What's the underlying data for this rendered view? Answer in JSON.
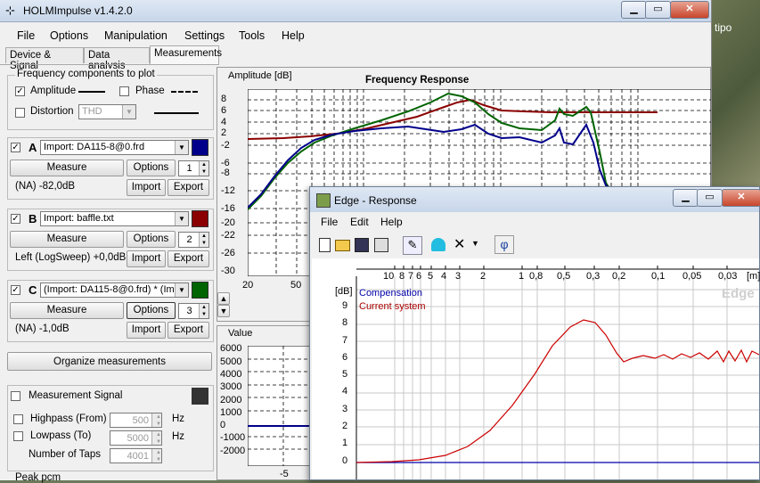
{
  "main_window": {
    "title": "HOLMImpulse   v1.4.2.0",
    "menu": [
      "File",
      "Options",
      "Manipulation",
      "Settings",
      "Tools",
      "Help"
    ],
    "tabs": [
      "Device & Signal",
      "Data analysis",
      "Measurements"
    ],
    "active_tab": "Measurements"
  },
  "freq_components": {
    "group_label": "Frequency components to plot",
    "amplitude_label": "Amplitude",
    "amplitude_checked": true,
    "phase_label": "Phase",
    "phase_checked": false,
    "distortion_label": "Distortion",
    "distortion_checked": false,
    "distortion_select": "THD"
  },
  "measurements": [
    {
      "letter": "A",
      "checked": true,
      "source": "Import: DA115-8@0.frd",
      "color": "#00008b",
      "measure": "Measure",
      "options": "Options",
      "index": "1",
      "info": "(NA) -82,0dB",
      "import": "Import",
      "export": "Export"
    },
    {
      "letter": "B",
      "checked": true,
      "source": "Import: baffle.txt",
      "color": "#8b0000",
      "measure": "Measure",
      "options": "Options",
      "index": "2",
      "info": "Left (LogSweep) +0,0dB",
      "import": "Import",
      "export": "Export"
    },
    {
      "letter": "C",
      "checked": true,
      "source": "(Import: DA115-8@0.frd) * (Impc",
      "color": "#006400",
      "measure": "Measure",
      "options": "Options",
      "index": "3",
      "info": "(NA) -1,0dB",
      "import": "Import",
      "export": "Export"
    }
  ],
  "organize_button": "Organize measurements",
  "measurement_signal": {
    "label": "Measurement Signal",
    "checked": false,
    "color": "#333333"
  },
  "filters": {
    "highpass_label": "Highpass (From)",
    "highpass_value": "500",
    "highpass_unit": "Hz",
    "lowpass_label": "Lowpass (To)",
    "lowpass_value": "5000",
    "lowpass_unit": "Hz",
    "taps_label": "Number of Taps",
    "taps_value": "4001"
  },
  "peak_label": "Peak pcm",
  "freq_plot": {
    "ylabel": "Amplitude [dB]",
    "title": "Frequency Response",
    "yticks": [
      "8",
      "6",
      "4",
      "2",
      "-2",
      "-6",
      "-8",
      "-12",
      "-16",
      "-20",
      "-22",
      "-26",
      "-30"
    ],
    "xticks": [
      "20",
      "50"
    ]
  },
  "value_plot": {
    "label": "Value",
    "yticks": [
      "6000",
      "5000",
      "4000",
      "3000",
      "2000",
      "1000",
      "0",
      "-1000",
      "-2000"
    ],
    "xtick": "-5"
  },
  "edge_window": {
    "title": "Edge - Response",
    "menu": [
      "File",
      "Edit",
      "Help"
    ],
    "toolbar_icons": [
      "new-icon",
      "open-icon",
      "save-icon",
      "copy-icon",
      "pen-icon",
      "person-icon",
      "delete-icon",
      "dropdown-icon",
      "phi-icon"
    ],
    "phi": "φ",
    "top_axis": [
      "10",
      "8",
      "7",
      "6",
      "5",
      "4",
      "3",
      "2",
      "1",
      "0,8",
      "0,5",
      "0,3",
      "0,2",
      "0,1",
      "0,05",
      "0,03",
      "[m]"
    ],
    "yunit": "[dB]",
    "yticks": [
      "9",
      "8",
      "7",
      "6",
      "5",
      "4",
      "3",
      "2",
      "1",
      "0"
    ],
    "legend": [
      {
        "name": "Compensation",
        "color": "#0000aa"
      },
      {
        "name": "Current system",
        "color": "#aa0000"
      }
    ],
    "watermark": "Edge"
  },
  "desktop_text": "tipo"
}
